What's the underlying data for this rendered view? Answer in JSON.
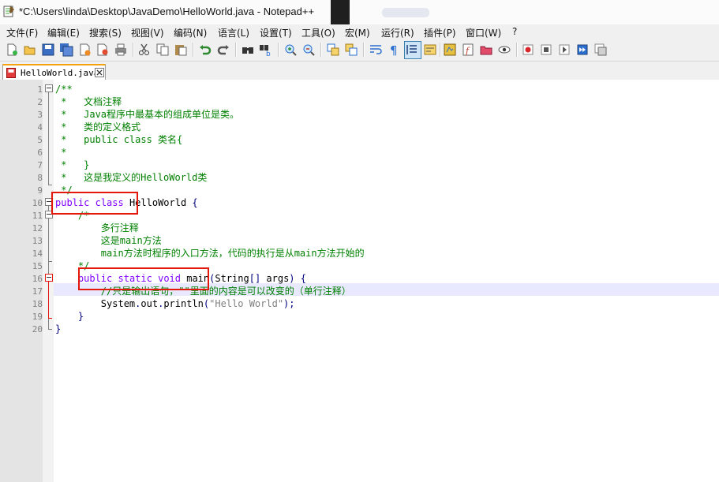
{
  "window": {
    "title": "*C:\\Users\\linda\\Desktop\\JavaDemo\\HelloWorld.java - Notepad++"
  },
  "menu": [
    "文件(F)",
    "编辑(E)",
    "搜索(S)",
    "视图(V)",
    "编码(N)",
    "语言(L)",
    "设置(T)",
    "工具(O)",
    "宏(M)",
    "运行(R)",
    "插件(P)",
    "窗口(W)",
    "?"
  ],
  "toolbar_icons": [
    "new-file-icon",
    "open-file-icon",
    "save-icon",
    "save-all-icon",
    "close-icon",
    "close-all-icon",
    "print-icon",
    "cut-icon",
    "copy-icon",
    "paste-icon",
    "undo-icon",
    "redo-icon",
    "find-icon",
    "replace-icon",
    "zoom-in-icon",
    "zoom-out-icon",
    "sync-v-icon",
    "sync-h-icon",
    "word-wrap-icon",
    "show-all-chars-icon",
    "indent-guide-icon",
    "lang-icon",
    "doc-map-icon",
    "function-list-icon",
    "folder-icon",
    "monitor-icon",
    "record-macro-icon",
    "stop-macro-icon",
    "play-macro-icon",
    "run-macro-multiple-icon",
    "save-macro-icon"
  ],
  "tab": {
    "label": "HelloWorld.java"
  },
  "editor": {
    "line_numbers": [
      "1",
      "2",
      "3",
      "4",
      "5",
      "6",
      "7",
      "8",
      "9",
      "10",
      "11",
      "12",
      "13",
      "14",
      "15",
      "16",
      "17",
      "18",
      "19",
      "20"
    ],
    "lines": [
      [
        {
          "t": "/**",
          "c": "cmt"
        }
      ],
      [
        {
          "t": " *   文档注释",
          "c": "cmt"
        }
      ],
      [
        {
          "t": " *   Java程序中最基本的组成单位是类。",
          "c": "cmt"
        }
      ],
      [
        {
          "t": " *   类的定义格式",
          "c": "cmt"
        }
      ],
      [
        {
          "t": " *   public class 类名{",
          "c": "cmt"
        }
      ],
      [
        {
          "t": " *",
          "c": "cmt"
        }
      ],
      [
        {
          "t": " *   }",
          "c": "cmt"
        }
      ],
      [
        {
          "t": " *   这是我定义的HelloWorld类",
          "c": "cmt"
        }
      ],
      [
        {
          "t": " */",
          "c": "cmt"
        }
      ],
      [
        {
          "t": "public",
          "c": "kw"
        },
        {
          "t": " ",
          "c": "tx"
        },
        {
          "t": "class",
          "c": "kw"
        },
        {
          "t": " HelloWorld ",
          "c": "tx"
        },
        {
          "t": "{",
          "c": "op"
        }
      ],
      [
        {
          "t": "    /*",
          "c": "cmt"
        }
      ],
      [
        {
          "t": "        多行注释",
          "c": "cmt"
        }
      ],
      [
        {
          "t": "        这是main方法",
          "c": "cmt"
        }
      ],
      [
        {
          "t": "        main方法时程序的入口方法，代码的执行是从main方法开始的",
          "c": "cmt"
        }
      ],
      [
        {
          "t": "    */",
          "c": "cmt"
        }
      ],
      [
        {
          "t": "    ",
          "c": "tx"
        },
        {
          "t": "public",
          "c": "kw"
        },
        {
          "t": " ",
          "c": "tx"
        },
        {
          "t": "static",
          "c": "kw"
        },
        {
          "t": " ",
          "c": "tx"
        },
        {
          "t": "void",
          "c": "kw"
        },
        {
          "t": " main",
          "c": "tx"
        },
        {
          "t": "(",
          "c": "op"
        },
        {
          "t": "String",
          "c": "tx"
        },
        {
          "t": "[]",
          "c": "op"
        },
        {
          "t": " args",
          "c": "tx"
        },
        {
          "t": ")",
          "c": "op"
        },
        {
          "t": " ",
          "c": "tx"
        },
        {
          "t": "{",
          "c": "op"
        }
      ],
      [
        {
          "t": "        //只是输出语句，\"\"里面的内容是可以改变的（单行注释）",
          "c": "cmt"
        }
      ],
      [
        {
          "t": "        System",
          "c": "tx"
        },
        {
          "t": ".",
          "c": "op"
        },
        {
          "t": "out",
          "c": "tx"
        },
        {
          "t": ".",
          "c": "op"
        },
        {
          "t": "println",
          "c": "tx"
        },
        {
          "t": "(",
          "c": "op"
        },
        {
          "t": "\"Hello World\"",
          "c": "str"
        },
        {
          "t": ");",
          "c": "op"
        }
      ],
      [
        {
          "t": "    ",
          "c": "tx"
        },
        {
          "t": "}",
          "c": "op"
        }
      ],
      [
        {
          "t": "}",
          "c": "op"
        }
      ]
    ]
  },
  "colors": {
    "comment": "#008000",
    "keyword": "#8000ff",
    "annotation_box": "#e3170a",
    "current_line": "#e8e8ff",
    "tab_accent": "#f4a20e"
  }
}
